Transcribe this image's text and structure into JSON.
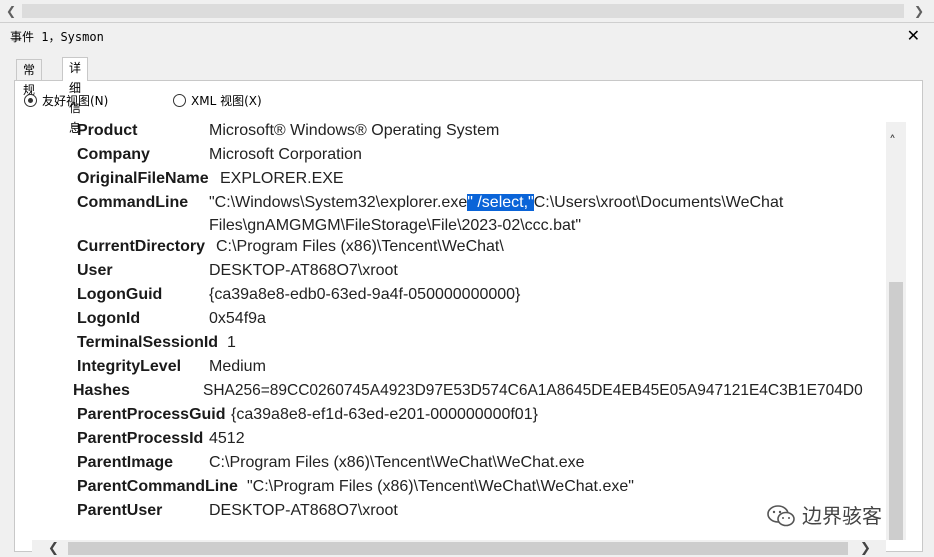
{
  "window": {
    "title": "事件 1，Sysmon",
    "close_glyph": "✕"
  },
  "tabs": [
    {
      "label": "常规"
    },
    {
      "label": "详细信息"
    }
  ],
  "view_options": {
    "friendly": "友好视图(N)",
    "xml": "XML 视图(X)",
    "selected": "friendly"
  },
  "details": [
    {
      "key": "Product",
      "value": "Microsoft® Windows® Operating System"
    },
    {
      "key": "Company",
      "value": "Microsoft Corporation"
    },
    {
      "key": "OriginalFileName",
      "value": "EXPLORER.EXE"
    },
    {
      "key": "CommandLine",
      "value_pre": "\"C:\\Windows\\System32\\explorer.exe",
      "value_selected": "\" /select,\"",
      "value_post": "C:\\Users\\xroot\\Documents\\WeChat",
      "value_line2": "Files\\gnAMGMGM\\FileStorage\\File\\2023-02\\ccc.bat\""
    },
    {
      "key": "CurrentDirectory",
      "value": "C:\\Program Files (x86)\\Tencent\\WeChat\\"
    },
    {
      "key": "User",
      "value": "DESKTOP-AT868O7\\xroot"
    },
    {
      "key": "LogonGuid",
      "value": "{ca39a8e8-edb0-63ed-9a4f-050000000000}"
    },
    {
      "key": "LogonId",
      "value": "0x54f9a"
    },
    {
      "key": "TerminalSessionId",
      "value": "1"
    },
    {
      "key": "IntegrityLevel",
      "value": "Medium"
    },
    {
      "key": "Hashes",
      "value": "SHA256=89CC0260745A4923D97E53D574C6A1A8645DE4EB45E05A947121E4C3B1E704D0"
    },
    {
      "key": "ParentProcessGuid",
      "value": "{ca39a8e8-ef1d-63ed-e201-000000000f01}"
    },
    {
      "key": "ParentProcessId",
      "value": "4512"
    },
    {
      "key": "ParentImage",
      "value": "C:\\Program Files (x86)\\Tencent\\WeChat\\WeChat.exe"
    },
    {
      "key": "ParentCommandLine",
      "value": "\"C:\\Program Files (x86)\\Tencent\\WeChat\\WeChat.exe\""
    },
    {
      "key": "ParentUser",
      "value": "DESKTOP-AT868O7\\xroot"
    }
  ],
  "watermark": {
    "text": "边界骇客",
    "icon": "wechat-icon"
  },
  "colors": {
    "selection": "#0a64d8"
  }
}
